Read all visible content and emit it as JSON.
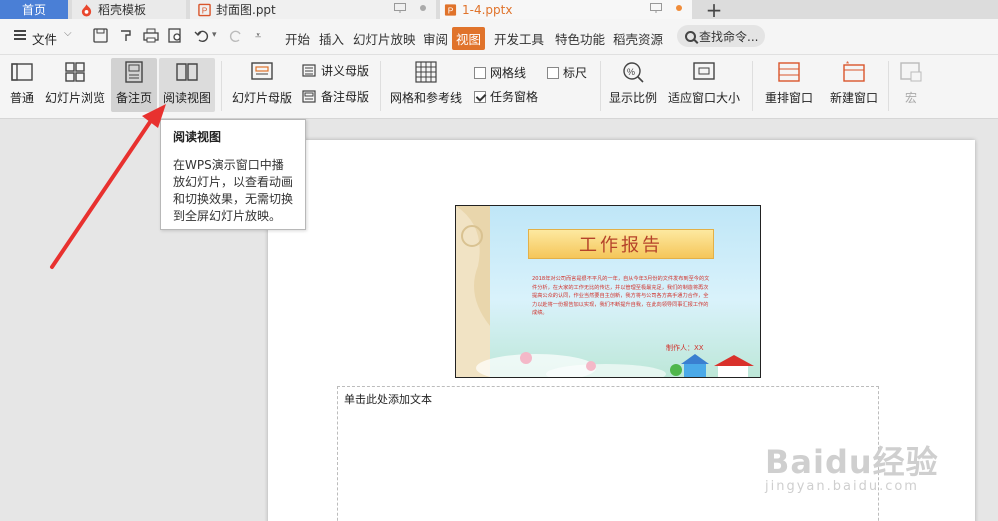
{
  "tabs": [
    {
      "label": "首页"
    },
    {
      "label": "稻壳模板"
    },
    {
      "label": "封面图.ppt"
    },
    {
      "label": "1-4.pptx"
    }
  ],
  "menubar": {
    "file": "文件",
    "tabs": [
      "开始",
      "插入",
      "幻灯片放映",
      "审阅",
      "视图",
      "开发工具",
      "特色功能",
      "稻壳资源"
    ],
    "active_tab": "视图",
    "search_placeholder": "查找命令..."
  },
  "ribbon": {
    "normal": "普通",
    "slide_browse": "幻灯片浏览",
    "notes_page": "备注页",
    "reading_view": "阅读视图",
    "slide_master": "幻灯片母版",
    "handout_master": "讲义母版",
    "notes_master": "备注母版",
    "grid_guides": "网格和参考线",
    "gridlines": "网格线",
    "ruler": "标尺",
    "task_pane": "任务窗格",
    "zoom": "显示比例",
    "fit_window": "适应窗口大小",
    "arrange": "重排窗口",
    "new_window": "新建窗口",
    "macro": "宏"
  },
  "tooltip": {
    "title": "阅读视图",
    "body": "在WPS演示窗口中播放幻灯片，以查看动画和切换效果，无需切换到全屏幻灯片放映。"
  },
  "slide": {
    "title": "工作报告",
    "body": "2018年对公司而言是很不平凡的一年，自从今年3月份的文件发布到至今的文件分析，在大家的工作无比的传达，并以管理至极最充足，我们的制造将再次提高公众的认同，作业当然要自主创新，我方将与公司各方高手通力合作，全力以赴将一份报告加以实现，我们不断提升自我，在此向领导同事汇报工作的成绩。",
    "author": "制作人：XX"
  },
  "notes_placeholder": "单击此处添加文本",
  "watermark": {
    "main": "Baidu经验",
    "sub": "jingyan.baidu.com"
  },
  "colors": {
    "accent": "#e0732b",
    "home_tab": "#4a7fd6",
    "arrow": "#e8312f"
  }
}
